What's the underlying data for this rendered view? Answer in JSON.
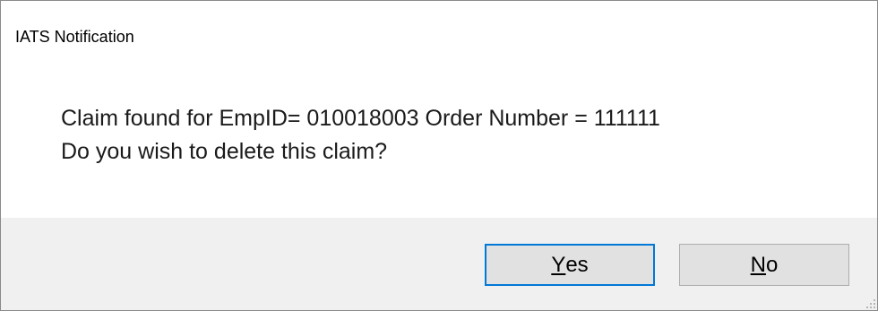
{
  "dialog": {
    "title": "IATS Notification",
    "message_line1": "Claim found for EmpID= 010018003 Order Number = 111111",
    "message_line2": "Do you wish to delete this claim?"
  },
  "buttons": {
    "yes": {
      "mnemonic": "Y",
      "rest": "es"
    },
    "no": {
      "mnemonic": "N",
      "rest": "o"
    }
  },
  "colors": {
    "focus_border": "#0078d7",
    "footer_bg": "#f0f0f0",
    "button_bg": "#e1e1e1"
  },
  "icons": [
    "resize-grip-icon"
  ]
}
